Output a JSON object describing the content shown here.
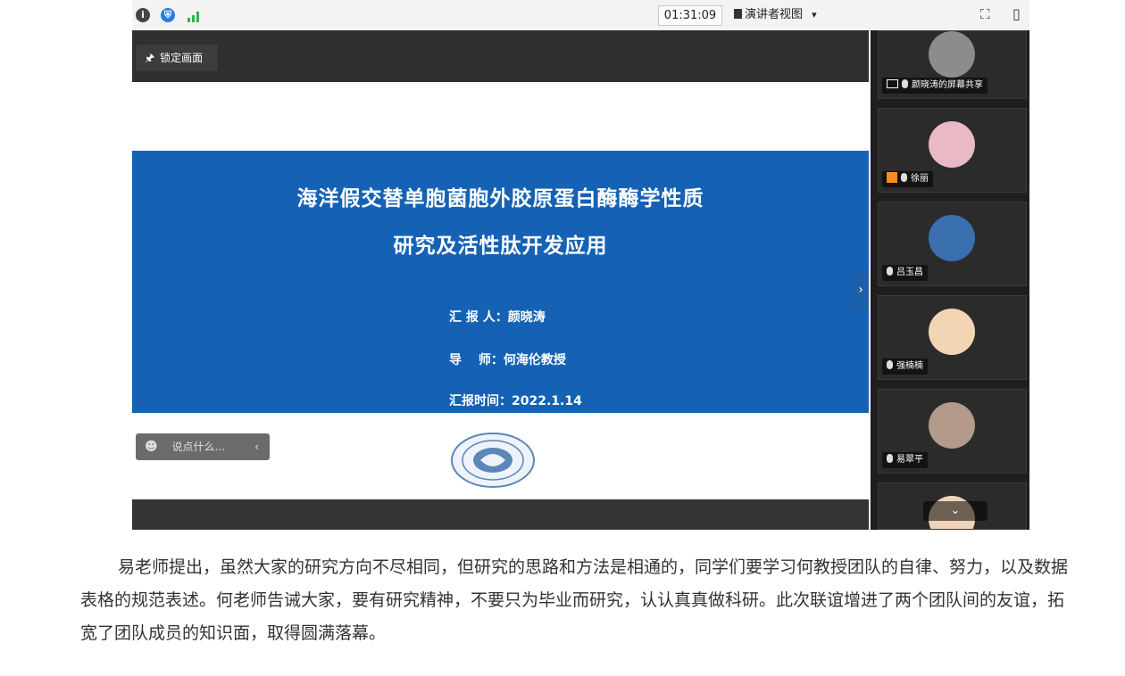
{
  "toolbar": {
    "timer": "01:31:09",
    "presenter_view": "演讲者视图",
    "presenter_dropdown": "▾",
    "fullscreen_icon": "⛶",
    "layout_icon": "▯",
    "info_icon": "i",
    "shield_icon": "⛨",
    "signal_icon": "▮"
  },
  "stage": {
    "lock_label": "锁定画面",
    "pin_icon": "🖈",
    "chat_placeholder": "说点什么...",
    "chat_emoji_icon": "☻",
    "chat_collapse_icon": "‹",
    "sidebar_toggle_icon": "›"
  },
  "slide": {
    "title_line1": "海洋假交替单胞菌胞外胶原蛋白酶酶学性质",
    "title_line2": "研究及活性肽开发应用",
    "reporter": "汇 报 人：颜晓涛",
    "advisor": "导　 师：何海伦教授",
    "report_time": "汇报时间：2022.1.14"
  },
  "participants": [
    {
      "name": "颜晓涛的屏幕共享",
      "avatar_color": "#8c8c8c"
    },
    {
      "name": "徐丽",
      "avatar_color": "#e9b9c6"
    },
    {
      "name": "吕玉昌",
      "avatar_color": "#3a6fb0"
    },
    {
      "name": "强楠楠",
      "avatar_color": "#f2d6b3"
    },
    {
      "name": "易翠平",
      "avatar_color": "#b39a8a"
    }
  ],
  "sidebar_more_icon": "⌄",
  "article": {
    "paragraph": "易老师提出，虽然大家的研究方向不尽相同，但研究的思路和方法是相通的，同学们要学习何教授团队的自律、努力，以及数据表格的规范表述。何老师告诫大家，要有研究精神，不要只为毕业而研究，认认真真做科研。此次联谊增进了两个团队间的友谊，拓宽了团队成员的知识面，取得圆满落幕。"
  }
}
